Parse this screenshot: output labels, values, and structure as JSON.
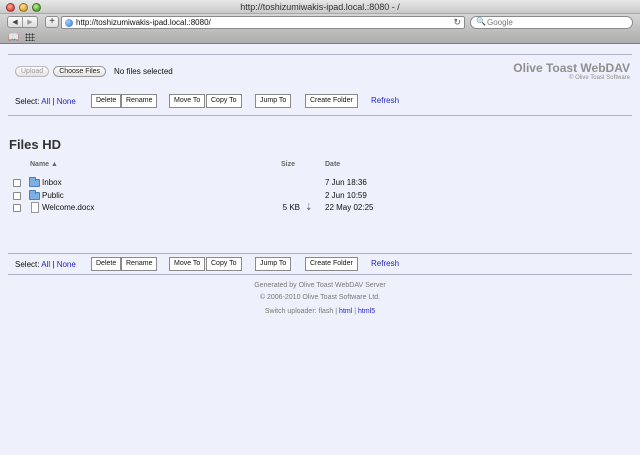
{
  "window": {
    "title": "http://toshizumiwakis-ipad.local.:8080 - /"
  },
  "browser": {
    "url": "http://toshizumiwakis-ipad.local.:8080/",
    "search_placeholder": "Google",
    "back": "◀",
    "forward": "▶",
    "add": "+",
    "reload": "↻",
    "search_glyph": "🔍"
  },
  "uploader": {
    "upload_label": "Upload",
    "choose_label": "Choose Files",
    "status": "No files selected"
  },
  "brand": {
    "title": "Olive Toast WebDAV",
    "subtitle": "© Olive Toast Software"
  },
  "actions": {
    "select_label": "Select:",
    "all": "All",
    "separator": "|",
    "none": "None",
    "delete": "Delete",
    "rename": "Rename",
    "move_to": "Move To",
    "copy_to": "Copy To",
    "jump_to": "Jump To",
    "create_folder": "Create Folder",
    "refresh": "Refresh"
  },
  "listing": {
    "heading": "Files HD",
    "columns": {
      "name": "Name ▲",
      "size": "Size",
      "date": "Date"
    },
    "rows": [
      {
        "name": "Inbox",
        "type": "folder-icon",
        "size": "",
        "date": "7 Jun 18:36"
      },
      {
        "name": "Public",
        "type": "folder-icon",
        "size": "",
        "date": "2 Jun 10:59"
      },
      {
        "name": "Welcome.docx",
        "type": "document-icon",
        "size": "5 KB",
        "download": "⇣",
        "date": "22 May 02:25"
      }
    ]
  },
  "footer": {
    "generated": "Generated by Olive Toast WebDAV Server",
    "copyright": "© 2006-2010 Olive Toast Software Ltd.",
    "switch_label": "Switch uploader: flash |",
    "html": "html",
    "sep": "|",
    "html5": "html5"
  },
  "colors": {
    "link": "#2525c8",
    "brand": "#8f8f8f",
    "page_bg": "#eef0fb"
  }
}
